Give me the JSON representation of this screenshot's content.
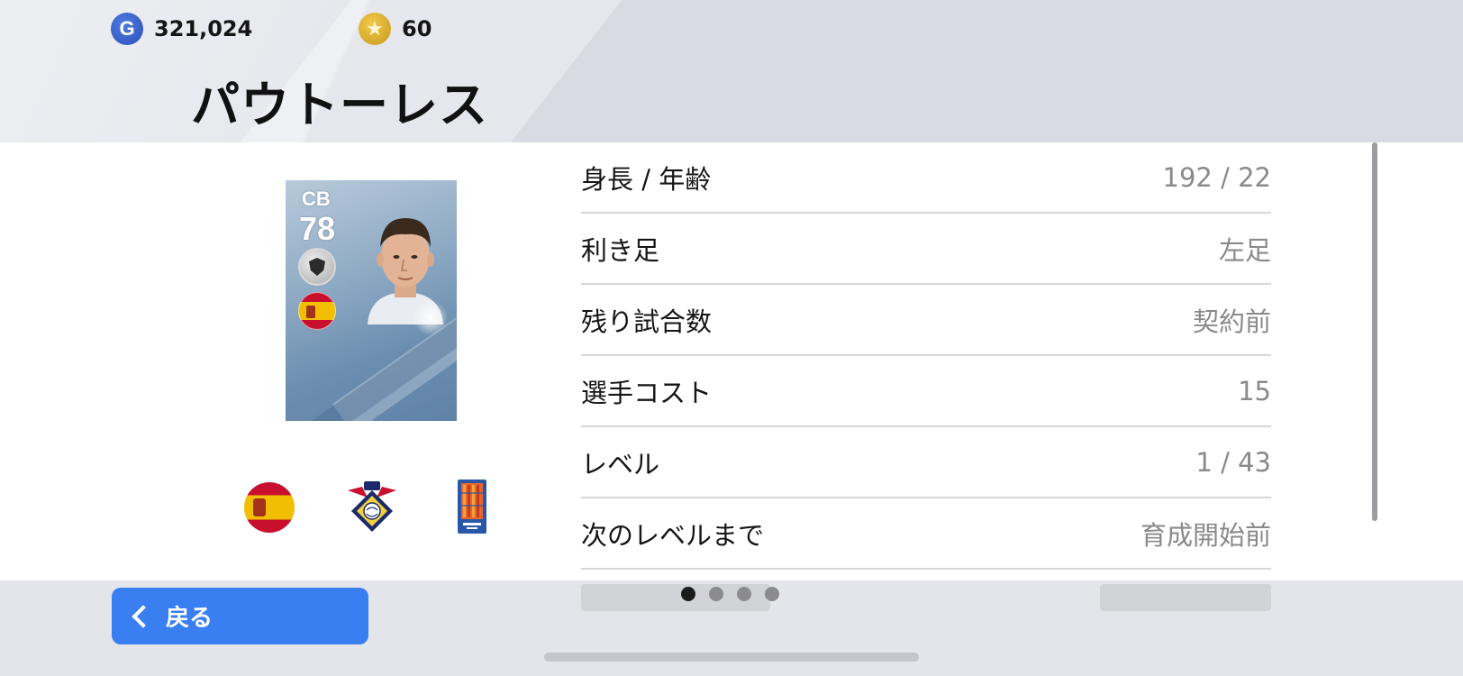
{
  "currency": {
    "gp_icon_label": "G",
    "gp_value": "321,024",
    "coins_icon": "star-coin-icon",
    "coins_value": "60"
  },
  "player": {
    "name": "パウトーレス",
    "card_position": "CB",
    "card_rating": "78"
  },
  "info_rows": [
    {
      "label": "身長 / 年齢",
      "value": "192 / 22"
    },
    {
      "label": "利き足",
      "value": "左足"
    },
    {
      "label": "残り試合数",
      "value": "契約前"
    },
    {
      "label": "選手コスト",
      "value": "15"
    },
    {
      "label": "レベル",
      "value": "1 / 43"
    },
    {
      "label": "次のレベルまで",
      "value": "育成開始前"
    }
  ],
  "footer": {
    "back_label": "戻る",
    "page_count": 4,
    "active_page": 1
  },
  "colors": {
    "accent_blue": "#3a7ff2",
    "header_bg": "#d9dbe2",
    "panel_bg": "#ffffff"
  }
}
